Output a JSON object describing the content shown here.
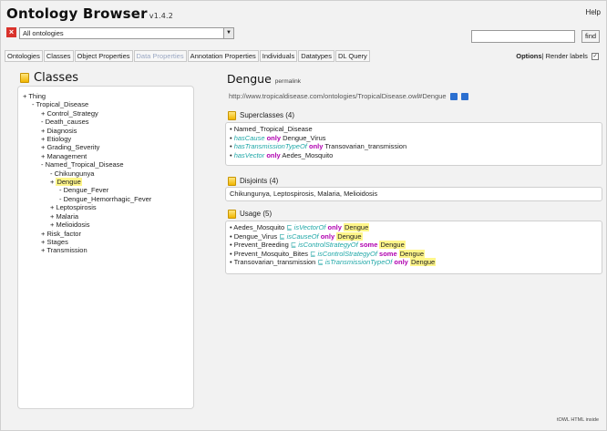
{
  "app": {
    "title": "Ontology Browser",
    "version": "v1.4.2",
    "help": "Help"
  },
  "ontology_select": {
    "value": "All ontologies"
  },
  "search": {
    "find_label": "find"
  },
  "tabs": [
    {
      "label": "Ontologies",
      "disabled": false
    },
    {
      "label": "Classes",
      "disabled": false
    },
    {
      "label": "Object Properties",
      "disabled": false
    },
    {
      "label": "Data Properties",
      "disabled": true
    },
    {
      "label": "Annotation Properties",
      "disabled": false
    },
    {
      "label": "Individuals",
      "disabled": false
    },
    {
      "label": "Datatypes",
      "disabled": false
    },
    {
      "label": "DL Query",
      "disabled": false
    }
  ],
  "options": {
    "label": "Options",
    "render_labels": "Render labels",
    "checked": true
  },
  "classes_panel": {
    "title": "Classes",
    "tree": [
      {
        "text": "+ Thing",
        "indent": 0
      },
      {
        "text": "- Tropical_Disease",
        "indent": 1
      },
      {
        "text": "+ Control_Strategy",
        "indent": 2
      },
      {
        "text": "- Death_causes",
        "indent": 2
      },
      {
        "text": "+ Diagnosis",
        "indent": 2
      },
      {
        "text": "+ Etiology",
        "indent": 2
      },
      {
        "text": "+ Grading_Severity",
        "indent": 2
      },
      {
        "text": "+ Management",
        "indent": 2
      },
      {
        "text": "- Named_Tropical_Disease",
        "indent": 2
      },
      {
        "text": "- Chikungunya",
        "indent": 3
      },
      {
        "text": "Dengue",
        "indent": 3,
        "highlight": true,
        "prefix": "+ "
      },
      {
        "text": "- Dengue_Fever",
        "indent": 4
      },
      {
        "text": "- Dengue_Hemorrhagic_Fever",
        "indent": 4
      },
      {
        "text": "+ Leptospirosis",
        "indent": 3
      },
      {
        "text": "+ Malaria",
        "indent": 3
      },
      {
        "text": "+ Melioidosis",
        "indent": 3
      },
      {
        "text": "+ Risk_factor",
        "indent": 2
      },
      {
        "text": "+ Stages",
        "indent": 2
      },
      {
        "text": "+ Transmission",
        "indent": 2
      }
    ]
  },
  "entity": {
    "name": "Dengue",
    "permalink": "permalink",
    "uri": "http://www.tropicaldisease.com/ontologies/TropicalDisease.owl#Dengue"
  },
  "superclasses": {
    "title": "Superclasses (4)",
    "items": [
      {
        "plain": "Named_Tropical_Disease"
      },
      {
        "prop": "hasCause",
        "kw": "only",
        "target": "Dengue_Virus"
      },
      {
        "prop": "hasTransmissionTypeOf",
        "kw": "only",
        "target": "Transovarian_transmission"
      },
      {
        "prop": "hasVector",
        "kw": "only",
        "target": "Aedes_Mosquito"
      }
    ]
  },
  "disjoints": {
    "title": "Disjoints (4)",
    "text": "Chikungunya, Leptospirosis, Malaria, Melioidosis"
  },
  "usage": {
    "title": "Usage (5)",
    "items": [
      {
        "subject": "Aedes_Mosquito",
        "op": "⊑",
        "prop": "isVectorOf",
        "kw": "only",
        "target": "Dengue"
      },
      {
        "subject": "Dengue_Virus",
        "op": "⊑",
        "prop": "isCauseOf",
        "kw": "only",
        "target": "Dengue"
      },
      {
        "subject": "Prevent_Breeding",
        "op": "⊑",
        "prop": "isControlStrategyOf",
        "kw": "some",
        "target": "Dengue"
      },
      {
        "subject": "Prevent_Mosquito_Bites",
        "op": "⊑",
        "prop": "isControlStrategyOf",
        "kw": "some",
        "target": "Dengue"
      },
      {
        "subject": "Transovarian_transmission",
        "op": "⊑",
        "prop": "isTransmissionTypeOf",
        "kw": "only",
        "target": "Dengue"
      }
    ]
  },
  "footer": "tOWL HTML inside"
}
